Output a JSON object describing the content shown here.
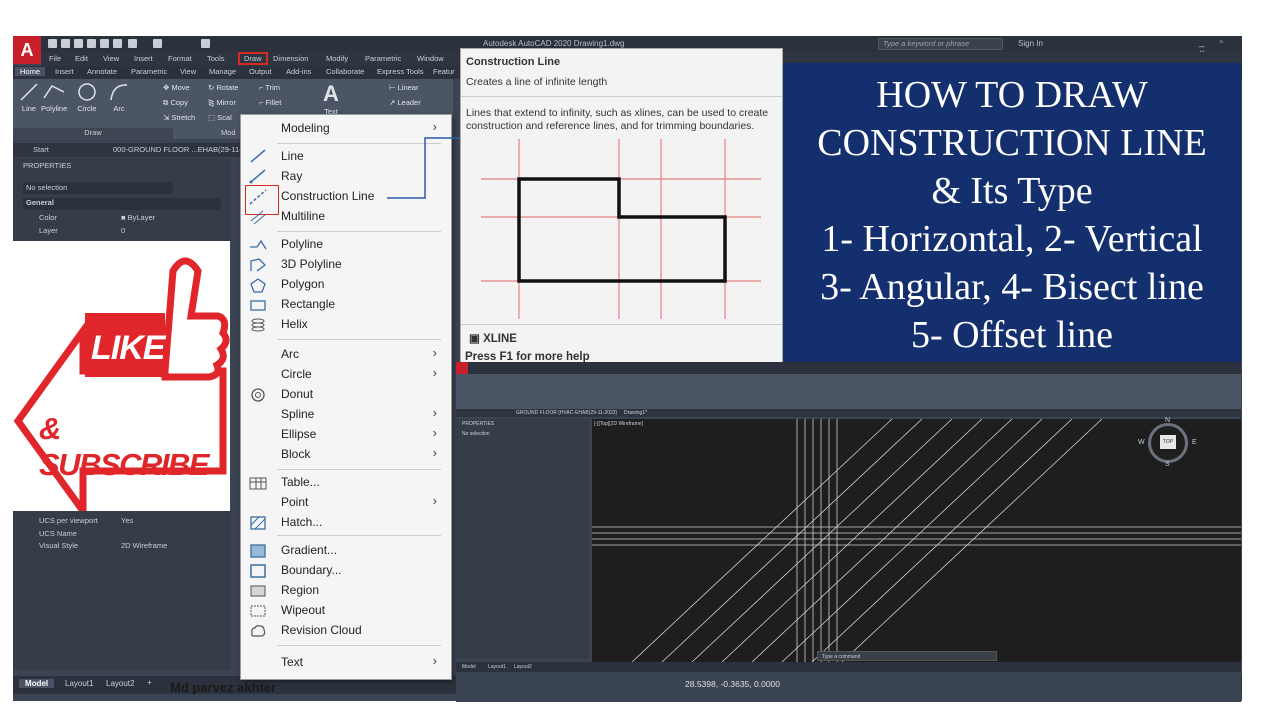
{
  "app": {
    "logo_letter": "A",
    "title": "Autodesk AutoCAD 2020   Drawing1.dwg",
    "search_placeholder": "Type a keyword or phrase",
    "sign_in": "Sign In",
    "window_controls": "_ ▫ ×"
  },
  "menubar": [
    "File",
    "Edit",
    "View",
    "Insert",
    "Format",
    "Tools",
    "Draw",
    "Dimension",
    "Modify",
    "Parametric",
    "Window"
  ],
  "ribbon_tabs": [
    "Home",
    "Insert",
    "Annotate",
    "Parametric",
    "View",
    "Manage",
    "Output",
    "Add-ins",
    "Collaborate",
    "Express Tools",
    "Featur"
  ],
  "ribbon": {
    "line": "Line",
    "polyline": "Polyline",
    "circle": "Circle",
    "arc": "Arc",
    "move": "Move",
    "rotate": "Rotate",
    "trim": "Trim",
    "copy": "Copy",
    "mirror": "Mirror",
    "fillet": "Fillet",
    "stretch": "Stretch",
    "scale": "Scal",
    "text": "Text",
    "linear": "Linear",
    "leader": "Leader",
    "draw_panel": "Draw",
    "mod_panel": "Mod"
  },
  "file_tabs": {
    "start": "Start",
    "drawing": "000-GROUND FLOOR ...EHAB(29-11-"
  },
  "properties": {
    "header": "PROPERTIES",
    "selection": "No selection",
    "general": "General",
    "color_label": "Color",
    "color_value": "ByLayer",
    "layer_label": "Layer",
    "layer_value": "0",
    "ucs_viewport_label": "UCS per viewport",
    "ucs_viewport_value": "Yes",
    "ucs_name_label": "UCS Name",
    "visual_style_label": "Visual Style",
    "visual_style_value": "2D Wireframe"
  },
  "status": {
    "model": "Model",
    "layout1": "Layout1",
    "layout2": "Layout2",
    "plus": "+",
    "coords": "28.5398, -0.3635, 0.0000"
  },
  "promo": {
    "like": "LIKE",
    "subscribe": "& SUBSCRIBE"
  },
  "author": "Md parvez akhter",
  "dropdown": {
    "modeling": "Modeling",
    "line": "Line",
    "ray": "Ray",
    "construction_line": "Construction Line",
    "multiline": "Multiline",
    "polyline": "Polyline",
    "polyline3d": "3D Polyline",
    "polygon": "Polygon",
    "rectangle": "Rectangle",
    "helix": "Helix",
    "arc": "Arc",
    "circle": "Circle",
    "donut": "Donut",
    "spline": "Spline",
    "ellipse": "Ellipse",
    "block": "Block",
    "table": "Table...",
    "point": "Point",
    "hatch": "Hatch...",
    "gradient": "Gradient...",
    "boundary": "Boundary...",
    "region": "Region",
    "wipeout": "Wipeout",
    "revision_cloud": "Revision Cloud",
    "text": "Text",
    "submenu_arrow": "›"
  },
  "tooltip": {
    "title": "Construction Line",
    "subtitle": "Creates a line of infinite length",
    "description": "Lines that extend to infinity, such as xlines, can be used to create construction and reference lines, and for trimming boundaries.",
    "command": "XLINE",
    "help": "Press F1 for more help"
  },
  "headline": {
    "line1": "HOW TO DRAW",
    "line2": "CONSTRUCTION LINE",
    "line3": "& Its Type",
    "line4": "1- Horizontal, 2- Vertical",
    "line5": "3- Angular, 4- Bisect line",
    "line6": "5- Offset line"
  },
  "second_window": {
    "file_tab": "GROUND FLOOR (HVAC-EHAB(29-11-2022)",
    "drawing_tab": "Drawing1*",
    "view_label": "[-][Top][2D Wireframe]",
    "compass_top": "TOP",
    "n": "N",
    "s": "S",
    "e": "E",
    "w": "W",
    "props_header": "PROPERTIES",
    "props_selection": "No selection",
    "model": "Model",
    "layout1": "Layout1",
    "layout2": "Layout2",
    "command_prompt": "Type a command"
  },
  "colors": {
    "autocad_bg": "#3b4453",
    "accent_red": "#d42a22",
    "headline_bg": "#142f6e",
    "promo_red": "#e0262b"
  }
}
